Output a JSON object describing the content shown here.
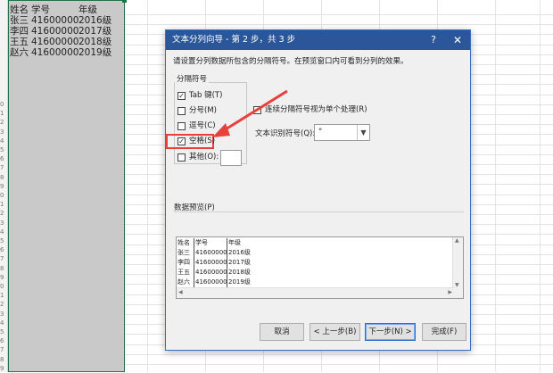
{
  "sheet": {
    "header_row": [
      "姓名",
      "学号",
      "年级"
    ],
    "rows": [
      [
        "张三",
        "41600000",
        "2016级"
      ],
      [
        "李四",
        "41600000",
        "2017级"
      ],
      [
        "王五",
        "41600000",
        "2018级"
      ],
      [
        "赵六",
        "41600000",
        "2019级"
      ]
    ],
    "row_numbers": [
      "0",
      "1",
      "2",
      "3",
      "4",
      "5",
      "6",
      "7",
      "8",
      "9",
      "0",
      "1",
      "2",
      "3",
      "4",
      "5",
      "6",
      "7",
      "8",
      "9",
      "0",
      "1",
      "2",
      "3",
      "4",
      "5",
      "6",
      "7",
      "8",
      "9"
    ]
  },
  "dialog": {
    "title": "文本分列向导 - 第 2 步，共 3 步",
    "help_glyph": "?",
    "close_glyph": "✕",
    "instruction": "请设置分列数据所包含的分隔符号。在预览窗口内可看到分列的效果。",
    "delimiters_group": "分隔符号",
    "delimiters": [
      {
        "label": "Tab 键(T)",
        "checked": true
      },
      {
        "label": "分号(M)",
        "checked": false
      },
      {
        "label": "逗号(C)",
        "checked": false
      },
      {
        "label": "空格(S)",
        "checked": true
      },
      {
        "label": "其他(O):",
        "checked": false
      }
    ],
    "consecutive_label": "连续分隔符号视为单个处理(R)",
    "consecutive_checked": false,
    "qualifier_label": "文本识别符号(Q):",
    "qualifier_value": "\"",
    "preview_label": "数据预览(P)",
    "preview_rows": [
      [
        "姓名",
        "学号",
        "年级"
      ],
      [
        "张三",
        "41600000",
        "2016级"
      ],
      [
        "李四",
        "41600000",
        "2017级"
      ],
      [
        "王五",
        "41600000",
        "2018级"
      ],
      [
        "赵六",
        "41600000",
        "2019级"
      ]
    ],
    "buttons": {
      "cancel": "取消",
      "back": "< 上一步(B)",
      "next": "下一步(N) >",
      "finish": "完成(F)"
    }
  },
  "colors": {
    "title_bar": "#2b579a",
    "selection_fill": "#c9c9c9",
    "selection_border": "#217346",
    "annotation_red": "#e8413b"
  }
}
